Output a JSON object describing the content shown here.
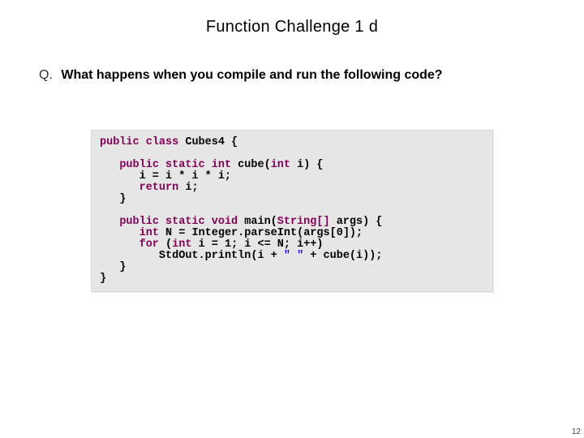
{
  "title": "Function Challenge 1 d",
  "question": {
    "label": "Q.",
    "text": "What happens when you compile and run the following code?"
  },
  "code": {
    "kw_public": "public",
    "kw_class": "class",
    "kw_static": "static",
    "kw_int": "int",
    "kw_void": "void",
    "kw_return": "return",
    "kw_for": "for",
    "kw_new_na": "",
    "class_name": "Cubes4",
    "m_cube": "cube",
    "m_main": "main",
    "t_string_arr": "String[]",
    "p_args": "args",
    "p_i": "i",
    "v_N": "N",
    "int_cls": "Integer",
    "parse": "parseInt",
    "args0": "args",
    "zero": "0",
    "one": "1",
    "stdout": "StdOut",
    "println": "println",
    "str_space": "\" \"",
    "line_cube_body": "i = i * i * i;",
    "line_return": "return i;"
  },
  "page_number": "12"
}
